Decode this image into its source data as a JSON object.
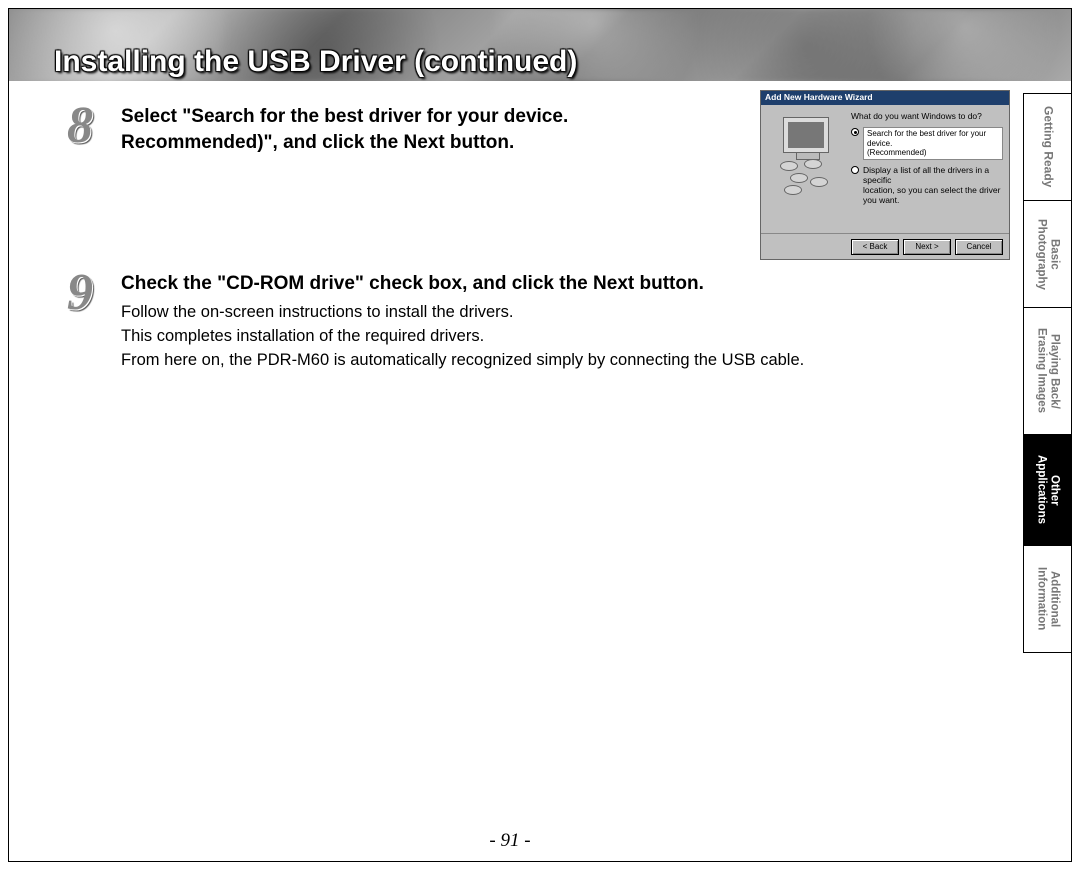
{
  "title": "Installing the USB Driver (continued)",
  "steps": {
    "s8": {
      "num": "8",
      "heading_line1": "Select \"Search for the best driver for your device.",
      "heading_line2": "Recommended)\", and click the Next button."
    },
    "s9": {
      "num": "9",
      "heading": "Check the \"CD-ROM drive\" check box, and click the Next button.",
      "body_line1": "Follow the on-screen instructions to install the drivers.",
      "body_line2": "This completes installation of the required drivers.",
      "body_line3": "From here on, the PDR-M60 is automatically recognized simply by connecting the USB cable."
    }
  },
  "wizard": {
    "title": "Add New Hardware Wizard",
    "prompt": "What do you want Windows to do?",
    "option1_line1": "Search for the best driver for your device.",
    "option1_line2": "(Recommended)",
    "option2_line1": "Display a list of all the drivers in a specific",
    "option2_line2": "location, so you can select the driver you want.",
    "back": "< Back",
    "next": "Next >",
    "cancel": "Cancel"
  },
  "tabs": {
    "t1": "Getting Ready",
    "t2": "Basic\nPhotography",
    "t3": "Playing Back/\nErasing Images",
    "t4": "Other\nApplications",
    "t5": "Additional\nInformation"
  },
  "page_number": "- 91 -"
}
